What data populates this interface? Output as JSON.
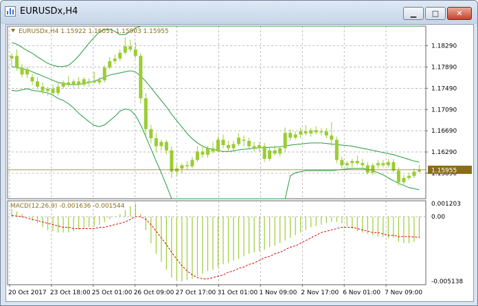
{
  "window": {
    "title": "EURUSDx,H4",
    "buttons": {
      "minimize": "▁",
      "maximize": "□",
      "close": "✕"
    }
  },
  "chart_data": {
    "type": "candlestick",
    "symbol_label": "EURUSDx,H4  1.15922 1.16051 1.15903 1.15955",
    "current_price_label": "1.15955",
    "current_price": 1.15955,
    "price_axis": {
      "ticks": [
        "1.18290",
        "1.17890",
        "1.17490",
        "1.17090",
        "1.16690",
        "1.16290",
        "1.15890"
      ],
      "ylim": [
        1.1541,
        1.1866
      ]
    },
    "time_axis": {
      "labels": [
        "20 Oct 2017",
        "23 Oct 18:00",
        "25 Oct 01:00",
        "26 Oct 09:00",
        "27 Oct 17:00",
        "31 Oct 01:00",
        "1 Nov 09:00",
        "2 Nov 17:00",
        "6 Nov 01:00",
        "7 Nov 09:00"
      ]
    },
    "grid": true,
    "colors": {
      "bull": "#9acd32",
      "bear": "#9acd32",
      "bands": "#1f9b3c",
      "grid": "#a0a0a0",
      "text": "#8a6d1a",
      "signal": "#e00000",
      "price_line": "#8a6d1a"
    },
    "candles": [
      {
        "o": 1.1805,
        "h": 1.1815,
        "l": 1.179,
        "c": 1.181
      },
      {
        "o": 1.181,
        "h": 1.1822,
        "l": 1.1782,
        "c": 1.1788
      },
      {
        "o": 1.1788,
        "h": 1.1795,
        "l": 1.177,
        "c": 1.1775
      },
      {
        "o": 1.1775,
        "h": 1.179,
        "l": 1.1768,
        "c": 1.1785
      },
      {
        "o": 1.177,
        "h": 1.1776,
        "l": 1.1755,
        "c": 1.1762
      },
      {
        "o": 1.1762,
        "h": 1.177,
        "l": 1.1748,
        "c": 1.1752
      },
      {
        "o": 1.1752,
        "h": 1.176,
        "l": 1.1738,
        "c": 1.1744
      },
      {
        "o": 1.1744,
        "h": 1.1752,
        "l": 1.1735,
        "c": 1.1748
      },
      {
        "o": 1.1748,
        "h": 1.1755,
        "l": 1.1736,
        "c": 1.174
      },
      {
        "o": 1.174,
        "h": 1.1758,
        "l": 1.1735,
        "c": 1.1752
      },
      {
        "o": 1.1752,
        "h": 1.1764,
        "l": 1.1748,
        "c": 1.176
      },
      {
        "o": 1.176,
        "h": 1.1772,
        "l": 1.1752,
        "c": 1.1756
      },
      {
        "o": 1.1756,
        "h": 1.1766,
        "l": 1.175,
        "c": 1.1762
      },
      {
        "o": 1.1762,
        "h": 1.177,
        "l": 1.175,
        "c": 1.1756
      },
      {
        "o": 1.1756,
        "h": 1.177,
        "l": 1.1752,
        "c": 1.1766
      },
      {
        "o": 1.176,
        "h": 1.1768,
        "l": 1.1752,
        "c": 1.1762
      },
      {
        "o": 1.1762,
        "h": 1.178,
        "l": 1.1758,
        "c": 1.176
      },
      {
        "o": 1.176,
        "h": 1.177,
        "l": 1.1756,
        "c": 1.1764
      },
      {
        "o": 1.1764,
        "h": 1.1792,
        "l": 1.176,
        "c": 1.1788
      },
      {
        "o": 1.1788,
        "h": 1.1808,
        "l": 1.1785,
        "c": 1.18
      },
      {
        "o": 1.18,
        "h": 1.1812,
        "l": 1.1795,
        "c": 1.1805
      },
      {
        "o": 1.1805,
        "h": 1.1822,
        "l": 1.18,
        "c": 1.1816
      },
      {
        "o": 1.1816,
        "h": 1.1845,
        "l": 1.1812,
        "c": 1.1828
      },
      {
        "o": 1.1828,
        "h": 1.184,
        "l": 1.1818,
        "c": 1.1822
      },
      {
        "o": 1.1822,
        "h": 1.1836,
        "l": 1.1805,
        "c": 1.181
      },
      {
        "o": 1.181,
        "h": 1.1815,
        "l": 1.172,
        "c": 1.173
      },
      {
        "o": 1.173,
        "h": 1.174,
        "l": 1.166,
        "c": 1.1672
      },
      {
        "o": 1.1672,
        "h": 1.168,
        "l": 1.1645,
        "c": 1.1655
      },
      {
        "o": 1.1655,
        "h": 1.1665,
        "l": 1.1628,
        "c": 1.164
      },
      {
        "o": 1.164,
        "h": 1.1652,
        "l": 1.1632,
        "c": 1.1648
      },
      {
        "o": 1.1648,
        "h": 1.1652,
        "l": 1.1625,
        "c": 1.1632
      },
      {
        "o": 1.1632,
        "h": 1.164,
        "l": 1.158,
        "c": 1.1592
      },
      {
        "o": 1.1592,
        "h": 1.1605,
        "l": 1.1584,
        "c": 1.1598
      },
      {
        "o": 1.1598,
        "h": 1.1608,
        "l": 1.1588,
        "c": 1.1604
      },
      {
        "o": 1.1604,
        "h": 1.1612,
        "l": 1.1596,
        "c": 1.1602
      },
      {
        "o": 1.1602,
        "h": 1.162,
        "l": 1.1598,
        "c": 1.1614
      },
      {
        "o": 1.1614,
        "h": 1.164,
        "l": 1.161,
        "c": 1.163
      },
      {
        "o": 1.163,
        "h": 1.1642,
        "l": 1.1618,
        "c": 1.1624
      },
      {
        "o": 1.1624,
        "h": 1.164,
        "l": 1.1618,
        "c": 1.1636
      },
      {
        "o": 1.1636,
        "h": 1.1648,
        "l": 1.1626,
        "c": 1.163
      },
      {
        "o": 1.163,
        "h": 1.1658,
        "l": 1.1628,
        "c": 1.1652
      },
      {
        "o": 1.1652,
        "h": 1.1662,
        "l": 1.1636,
        "c": 1.1642
      },
      {
        "o": 1.1642,
        "h": 1.165,
        "l": 1.163,
        "c": 1.1636
      },
      {
        "o": 1.1636,
        "h": 1.165,
        "l": 1.163,
        "c": 1.1644
      },
      {
        "o": 1.1644,
        "h": 1.1664,
        "l": 1.164,
        "c": 1.1656
      },
      {
        "o": 1.1652,
        "h": 1.166,
        "l": 1.164,
        "c": 1.165
      },
      {
        "o": 1.165,
        "h": 1.1656,
        "l": 1.1636,
        "c": 1.164
      },
      {
        "o": 1.164,
        "h": 1.1648,
        "l": 1.163,
        "c": 1.1636
      },
      {
        "o": 1.1636,
        "h": 1.1648,
        "l": 1.1628,
        "c": 1.1642
      },
      {
        "o": 1.164,
        "h": 1.1646,
        "l": 1.161,
        "c": 1.1616
      },
      {
        "o": 1.1616,
        "h": 1.1638,
        "l": 1.1612,
        "c": 1.1632
      },
      {
        "o": 1.1632,
        "h": 1.1642,
        "l": 1.1622,
        "c": 1.1626
      },
      {
        "o": 1.1626,
        "h": 1.164,
        "l": 1.162,
        "c": 1.1636
      },
      {
        "o": 1.1636,
        "h": 1.1675,
        "l": 1.163,
        "c": 1.1665
      },
      {
        "o": 1.1665,
        "h": 1.1672,
        "l": 1.165,
        "c": 1.1656
      },
      {
        "o": 1.1656,
        "h": 1.1668,
        "l": 1.1652,
        "c": 1.1662
      },
      {
        "o": 1.1662,
        "h": 1.1675,
        "l": 1.1655,
        "c": 1.1668
      },
      {
        "o": 1.1668,
        "h": 1.168,
        "l": 1.166,
        "c": 1.1664
      },
      {
        "o": 1.1664,
        "h": 1.1674,
        "l": 1.1658,
        "c": 1.167
      },
      {
        "o": 1.167,
        "h": 1.1678,
        "l": 1.1662,
        "c": 1.1666
      },
      {
        "o": 1.1666,
        "h": 1.1674,
        "l": 1.166,
        "c": 1.1668
      },
      {
        "o": 1.1668,
        "h": 1.1674,
        "l": 1.1655,
        "c": 1.166
      },
      {
        "o": 1.166,
        "h": 1.1685,
        "l": 1.164,
        "c": 1.1652
      },
      {
        "o": 1.1652,
        "h": 1.1658,
        "l": 1.1608,
        "c": 1.1614
      },
      {
        "o": 1.1614,
        "h": 1.162,
        "l": 1.1598,
        "c": 1.1604
      },
      {
        "o": 1.1604,
        "h": 1.1612,
        "l": 1.1596,
        "c": 1.1608
      },
      {
        "o": 1.1608,
        "h": 1.1616,
        "l": 1.16,
        "c": 1.1612
      },
      {
        "o": 1.1612,
        "h": 1.1622,
        "l": 1.1604,
        "c": 1.1608
      },
      {
        "o": 1.1608,
        "h": 1.1616,
        "l": 1.1598,
        "c": 1.1604
      },
      {
        "o": 1.1604,
        "h": 1.161,
        "l": 1.1586,
        "c": 1.159
      },
      {
        "o": 1.159,
        "h": 1.1608,
        "l": 1.1586,
        "c": 1.1604
      },
      {
        "o": 1.1604,
        "h": 1.1614,
        "l": 1.1598,
        "c": 1.1608
      },
      {
        "o": 1.1608,
        "h": 1.1614,
        "l": 1.16,
        "c": 1.1604
      },
      {
        "o": 1.1604,
        "h": 1.1616,
        "l": 1.16,
        "c": 1.161
      },
      {
        "o": 1.161,
        "h": 1.1616,
        "l": 1.159,
        "c": 1.1594
      },
      {
        "o": 1.1594,
        "h": 1.16,
        "l": 1.1566,
        "c": 1.1572
      },
      {
        "o": 1.1572,
        "h": 1.1586,
        "l": 1.1568,
        "c": 1.158
      },
      {
        "o": 1.158,
        "h": 1.159,
        "l": 1.1576,
        "c": 1.1584
      },
      {
        "o": 1.1584,
        "h": 1.1598,
        "l": 1.158,
        "c": 1.1592
      },
      {
        "o": 1.15922,
        "h": 1.16051,
        "l": 1.15903,
        "c": 1.15955
      }
    ],
    "bollinger": {
      "upper": [
        1.1835,
        1.1832,
        1.1826,
        1.182,
        1.1815,
        1.1808,
        1.1802,
        1.1796,
        1.1792,
        1.179,
        1.179,
        1.1792,
        1.18,
        1.181,
        1.1822,
        1.1834,
        1.1845,
        1.1855,
        1.186,
        1.186,
        1.1856,
        1.185,
        1.185,
        1.1856,
        1.1862,
        1.1866,
        1.1866,
        1.1866,
        1.1866,
        1.1866,
        1.1866,
        1.1866,
        1.1866,
        1.1866,
        1.1866,
        1.1866,
        1.1866,
        1.1866,
        1.1866,
        1.1866,
        1.1866,
        1.1866,
        1.1866,
        1.1866,
        1.1866,
        1.1866,
        1.1866,
        1.1866,
        1.1866,
        1.1866,
        1.1866,
        1.1866,
        1.1866,
        1.1866,
        1.1866,
        1.1866,
        1.1866,
        1.1866,
        1.1866,
        1.1866,
        1.1866,
        1.1866,
        1.1866,
        1.1866,
        1.1866,
        1.1866,
        1.1866,
        1.1866,
        1.1866,
        1.1866,
        1.1866,
        1.1866,
        1.1866,
        1.1866,
        1.1866,
        1.1866,
        1.1866,
        1.1866,
        1.1866,
        1.1866
      ],
      "middle": [
        1.179,
        1.1788,
        1.1786,
        1.1784,
        1.178,
        1.1776,
        1.1772,
        1.1768,
        1.1764,
        1.176,
        1.1758,
        1.1756,
        1.1756,
        1.1756,
        1.1758,
        1.176,
        1.1762,
        1.1766,
        1.177,
        1.1774,
        1.1776,
        1.1778,
        1.178,
        1.1782,
        1.178,
        1.1772,
        1.1762,
        1.175,
        1.1738,
        1.1726,
        1.1714,
        1.17,
        1.1688,
        1.1676,
        1.1664,
        1.1654,
        1.1646,
        1.164,
        1.1636,
        1.1634,
        1.1632,
        1.163,
        1.163,
        1.1631,
        1.1633,
        1.1634,
        1.1635,
        1.1636,
        1.1637,
        1.1637,
        1.1638,
        1.1638,
        1.1639,
        1.164,
        1.1642,
        1.1643,
        1.1644,
        1.1645,
        1.1646,
        1.1646,
        1.1646,
        1.1645,
        1.1644,
        1.1643,
        1.1642,
        1.1641,
        1.164,
        1.1638,
        1.1636,
        1.1634,
        1.1632,
        1.163,
        1.1628,
        1.1626,
        1.1624,
        1.1621,
        1.1618,
        1.1615,
        1.1612,
        1.161
      ],
      "lower": [
        1.1745,
        1.1744,
        1.1746,
        1.1748,
        1.1745,
        1.1744,
        1.1742,
        1.174,
        1.1736,
        1.173,
        1.1726,
        1.172,
        1.1712,
        1.1702,
        1.1694,
        1.1686,
        1.1679,
        1.1677,
        1.168,
        1.1688,
        1.1696,
        1.1706,
        1.171,
        1.1708,
        1.1698,
        1.168,
        1.1658,
        1.1635,
        1.1612,
        1.159,
        1.1566,
        1.1541,
        1.1541,
        1.1541,
        1.1541,
        1.1541,
        1.1541,
        1.1541,
        1.1541,
        1.1541,
        1.1541,
        1.1541,
        1.1541,
        1.1541,
        1.1541,
        1.1541,
        1.1541,
        1.1541,
        1.1541,
        1.1541,
        1.1541,
        1.1541,
        1.1541,
        1.1541,
        1.1584,
        1.159,
        1.1592,
        1.1594,
        1.1594,
        1.1594,
        1.1594,
        1.1594,
        1.1594,
        1.1595,
        1.1596,
        1.1597,
        1.1598,
        1.1598,
        1.1598,
        1.1596,
        1.1594,
        1.159,
        1.1586,
        1.158,
        1.1575,
        1.157,
        1.1566,
        1.1562,
        1.156,
        1.1558
      ]
    },
    "macd": {
      "label": "MACD(12,26,9) -0.001636 -0.001544",
      "ticks": [
        "0.001203",
        "0.00",
        "-0.005138"
      ],
      "ylim": [
        -0.005138,
        0.001203
      ],
      "histogram": [
        0.0006,
        0.0004,
        0.0002,
        0.0,
        -0.0003,
        -0.0005,
        -0.0008,
        -0.001,
        -0.0011,
        -0.0012,
        -0.0012,
        -0.0012,
        -0.0011,
        -0.001,
        -0.0009,
        -0.0008,
        -0.0007,
        -0.0006,
        -0.0004,
        -0.0002,
        0.0,
        0.0002,
        0.0005,
        0.0008,
        0.001,
        0.0002,
        -0.001,
        -0.002,
        -0.0028,
        -0.0034,
        -0.004,
        -0.0046,
        -0.0048,
        -0.0049,
        -0.0048,
        -0.0047,
        -0.0045,
        -0.0043,
        -0.0041,
        -0.004,
        -0.0038,
        -0.0036,
        -0.0035,
        -0.0033,
        -0.0032,
        -0.003,
        -0.0028,
        -0.0027,
        -0.0026,
        -0.0025,
        -0.0023,
        -0.0022,
        -0.002,
        -0.0018,
        -0.0016,
        -0.0014,
        -0.0012,
        -0.001,
        -0.0008,
        -0.0007,
        -0.0006,
        -0.0005,
        -0.0004,
        -0.0004,
        -0.0005,
        -0.0007,
        -0.0009,
        -0.0011,
        -0.0012,
        -0.0013,
        -0.0014,
        -0.0015,
        -0.0015,
        -0.0016,
        -0.0016,
        -0.0019,
        -0.002,
        -0.002,
        -0.0019,
        -0.00164
      ],
      "signal": [
        0.0001,
        5e-05,
        0.0,
        -0.0001,
        -0.0002,
        -0.0003,
        -0.0004,
        -0.0005,
        -0.0006,
        -0.0007,
        -0.0008,
        -0.0008,
        -0.0009,
        -0.0009,
        -0.0009,
        -0.0009,
        -0.0009,
        -0.0008,
        -0.0008,
        -0.0007,
        -0.0006,
        -0.0005,
        -0.0004,
        -0.0002,
        0.0,
        0.0,
        -0.0002,
        -0.0006,
        -0.0011,
        -0.0016,
        -0.0021,
        -0.0027,
        -0.0032,
        -0.0037,
        -0.0041,
        -0.0044,
        -0.0046,
        -0.0047,
        -0.0047,
        -0.0046,
        -0.0045,
        -0.0044,
        -0.0042,
        -0.0041,
        -0.0039,
        -0.0038,
        -0.0036,
        -0.0035,
        -0.0033,
        -0.0031,
        -0.003,
        -0.0028,
        -0.0027,
        -0.0025,
        -0.0023,
        -0.0022,
        -0.002,
        -0.0018,
        -0.0016,
        -0.0014,
        -0.0012,
        -0.0011,
        -0.001,
        -0.0009,
        -0.0008,
        -0.0008,
        -0.0008,
        -0.0009,
        -0.001,
        -0.0011,
        -0.0012,
        -0.0012,
        -0.0013,
        -0.0014,
        -0.0014,
        -0.0015,
        -0.0015,
        -0.0015,
        -0.00154,
        -0.001544
      ]
    }
  }
}
